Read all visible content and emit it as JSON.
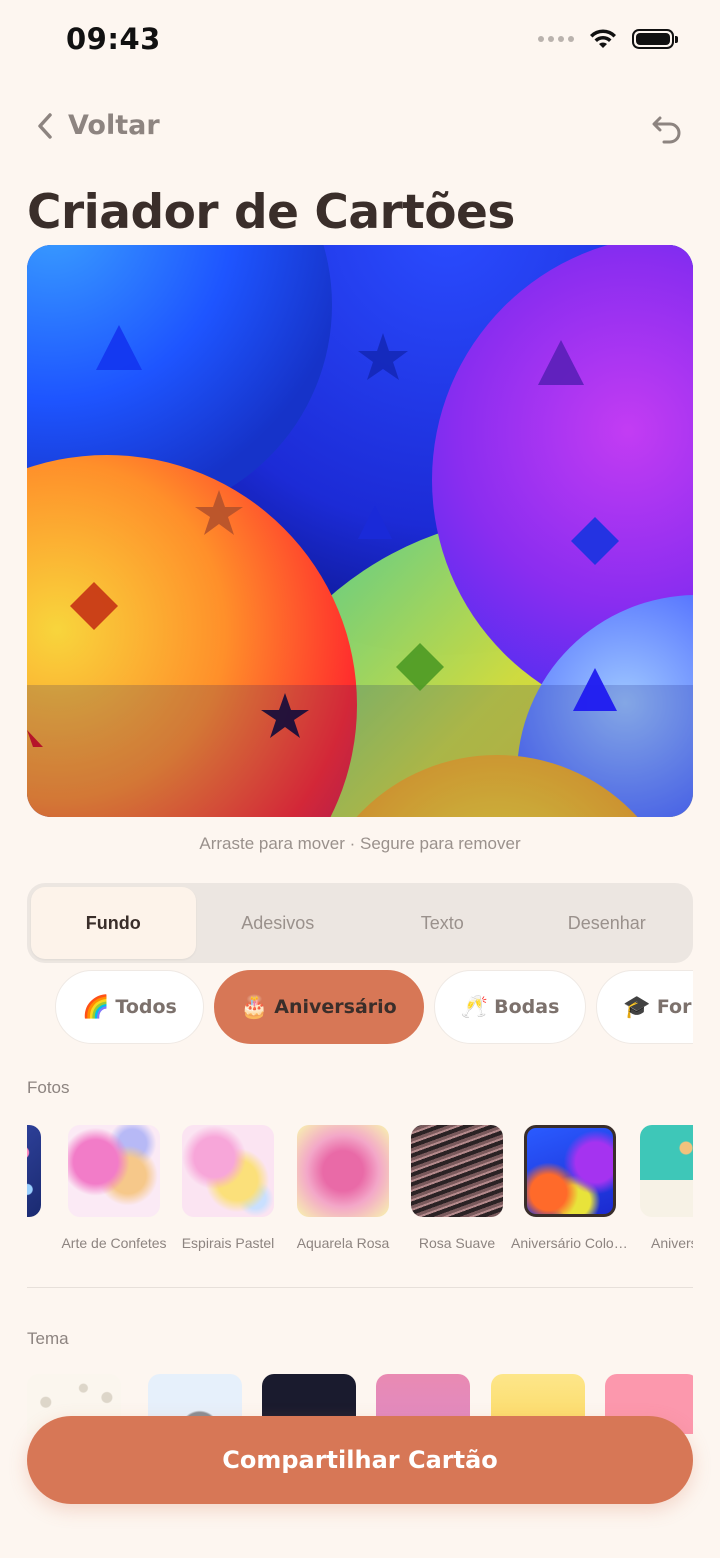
{
  "status": {
    "time": "09:43"
  },
  "nav": {
    "back_label": "Voltar"
  },
  "title": "Criador de Cartões",
  "canvas": {
    "hint": "Arraste para mover · Segure para remover"
  },
  "tabs": [
    {
      "label": "Fundo",
      "active": true
    },
    {
      "label": "Adesivos",
      "active": false
    },
    {
      "label": "Texto",
      "active": false
    },
    {
      "label": "Desenhar",
      "active": false
    }
  ],
  "categories": [
    {
      "emoji": "🌈",
      "label": "Todos",
      "active": false
    },
    {
      "emoji": "🎂",
      "label": "Aniversário",
      "active": true
    },
    {
      "emoji": "🥂",
      "label": "Bodas",
      "active": false
    },
    {
      "emoji": "🎓",
      "label": "Formatura",
      "active": false
    }
  ],
  "photos_section": {
    "label": "Fotos",
    "items": [
      {
        "caption": "Arte de Confetes"
      },
      {
        "caption": "Espirais Pastel"
      },
      {
        "caption": "Aquarela Rosa"
      },
      {
        "caption": "Rosa Suave"
      },
      {
        "caption": "Aniversário Colorido",
        "selected": true
      },
      {
        "caption": "Aniversário"
      }
    ]
  },
  "theme_section": {
    "label": "Tema"
  },
  "share_button": "Compartilhar Cartão",
  "colors": {
    "accent": "#d77756",
    "background": "#fdf6f0",
    "text": "#3a2e2a"
  }
}
